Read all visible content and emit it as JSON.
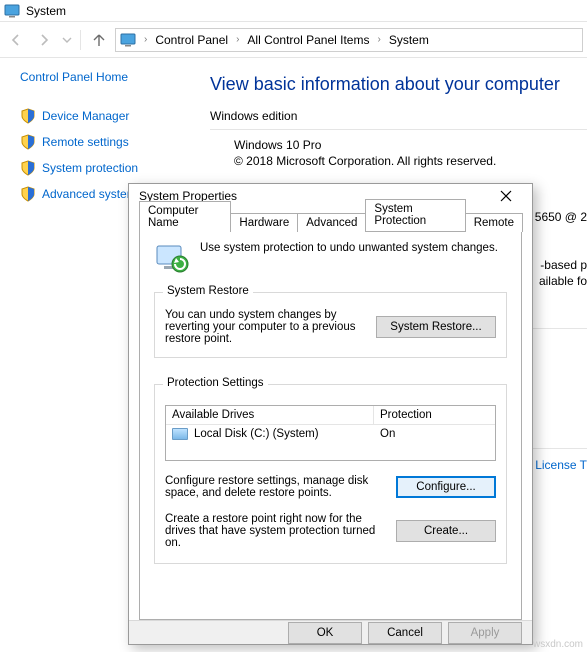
{
  "window": {
    "title": "System"
  },
  "breadcrumb": {
    "items": [
      "Control Panel",
      "All Control Panel Items",
      "System"
    ]
  },
  "sidebar": {
    "home": "Control Panel Home",
    "links": [
      "Device Manager",
      "Remote settings",
      "System protection",
      "Advanced system settings"
    ]
  },
  "content": {
    "heading": "View basic information about your computer",
    "edition_title": "Windows edition",
    "edition_name": "Windows 10 Pro",
    "copyright": "© 2018 Microsoft Corporation. All rights reserved.",
    "proc_frag": "5650  @ 2",
    "feat_frag1": "-based p",
    "feat_frag2": "ailable fo",
    "license_link": "License T"
  },
  "dialog": {
    "title": "System Properties",
    "tabs": [
      "Computer Name",
      "Hardware",
      "Advanced",
      "System Protection",
      "Remote"
    ],
    "hero": "Use system protection to undo unwanted system changes.",
    "restore": {
      "group_title": "System Restore",
      "text": "You can undo system changes by reverting your computer to a previous restore point.",
      "button": "System Restore..."
    },
    "protection": {
      "group_title": "Protection Settings",
      "col1": "Available Drives",
      "col2": "Protection",
      "drive_name": "Local Disk (C:) (System)",
      "drive_status": "On",
      "configure_text": "Configure restore settings, manage disk space, and delete restore points.",
      "configure_btn": "Configure...",
      "create_text": "Create a restore point right now for the drives that have system protection turned on.",
      "create_btn": "Create..."
    },
    "footer": {
      "ok": "OK",
      "cancel": "Cancel",
      "apply": "Apply"
    }
  },
  "watermark": "wsxdn.com"
}
